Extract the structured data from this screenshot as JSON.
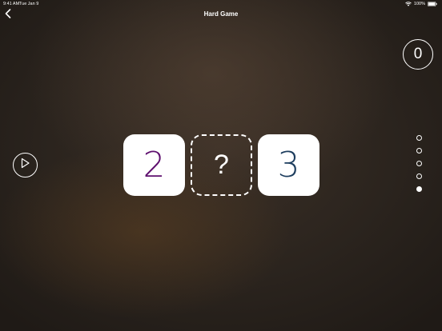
{
  "status_bar": {
    "time": "9:41 AM",
    "date": "Tue Jan 9",
    "battery": "100%"
  },
  "nav": {
    "title": "Hard Game",
    "back_icon": "chevron-left-icon"
  },
  "score": "0",
  "play_icon": "play-icon",
  "puzzle": {
    "left_value": "2",
    "left_color": "#5e0f6e",
    "answer_placeholder": "?",
    "right_value": "3",
    "right_color": "#1d3d5e"
  },
  "levels": {
    "total": 5,
    "active_index": 4
  }
}
